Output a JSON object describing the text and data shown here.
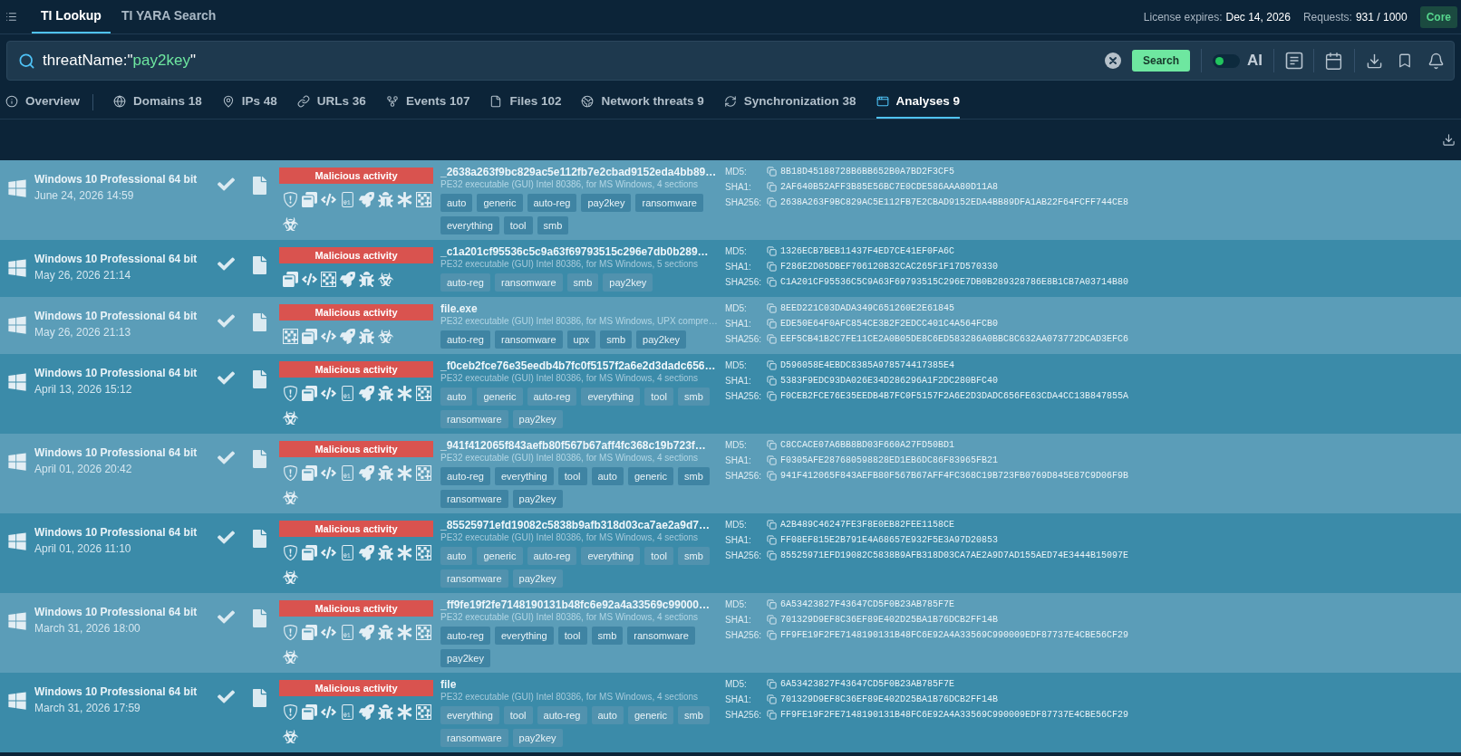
{
  "top_nav": {
    "tabs": [
      {
        "label": "TI Lookup",
        "selected": true
      },
      {
        "label": "TI YARA Search",
        "selected": false
      }
    ],
    "license": {
      "label": "License expires:",
      "value": "Dec 14, 2026"
    },
    "requests": {
      "label": "Requests:",
      "value": "931 / 1000"
    },
    "plan": "Core"
  },
  "search": {
    "query": [
      {
        "kind": "field",
        "text": "threatName:\""
      },
      {
        "kind": "value",
        "text": "pay2key"
      },
      {
        "kind": "field",
        "text": "\""
      }
    ],
    "button": "Search",
    "ai": {
      "label": "AI",
      "on": false
    }
  },
  "result_tabs": [
    {
      "kind": "info",
      "label": "Overview",
      "selected": false
    },
    {
      "kind": "globe",
      "label": "Domains 18",
      "selected": false
    },
    {
      "kind": "pin",
      "label": "IPs 48",
      "selected": false
    },
    {
      "kind": "link",
      "label": "URLs 36",
      "selected": false
    },
    {
      "kind": "fork",
      "label": "Events 107",
      "selected": false
    },
    {
      "kind": "file",
      "label": "Files 102",
      "selected": false
    },
    {
      "kind": "network",
      "label": "Network threats 9",
      "selected": false
    },
    {
      "kind": "sync",
      "label": "Synchronization 38",
      "selected": false
    },
    {
      "kind": "window",
      "label": "Analyses 9",
      "selected": true
    }
  ],
  "analyses": [
    {
      "os": "Windows 10 Professional 64 bit",
      "date": "June 24, 2026 14:59",
      "verdict": {
        "kind": "malicious",
        "label": "Malicious activity"
      },
      "indicators": [
        {
          "kind": "shield"
        },
        {
          "kind": "windows"
        },
        {
          "kind": "code"
        },
        {
          "kind": "binary"
        },
        {
          "kind": "rocket"
        },
        {
          "kind": "bug"
        },
        {
          "kind": "asterisk"
        },
        {
          "kind": "grid"
        },
        {
          "kind": "biohazard"
        }
      ],
      "name": "_2638a263f9bc829ac5e112fb7e2cbad9152eda4bb89…",
      "description": "PE32 executable (GUI) Intel 80386, for MS Windows, 4 sections",
      "tags": [
        "auto",
        "generic",
        "auto-reg",
        "pay2key",
        "ransomware",
        "everything",
        "tool",
        "smb"
      ],
      "hashes": [
        {
          "label": "MD5:",
          "value": "8B18D45188728B6BB652B0A7BD2F3CF5"
        },
        {
          "label": "SHA1:",
          "value": "2AF640B52AFF3B85E56BC7E0CDE586AAA80D11A8"
        },
        {
          "label": "SHA256:",
          "value": "2638A263F9BC829AC5E112FB7E2CBAD9152EDA4BB89DFA1AB22F64FCFF744CE8"
        }
      ]
    },
    {
      "os": "Windows 10 Professional 64 bit",
      "date": "May 26, 2026 21:14",
      "verdict": {
        "kind": "malicious",
        "label": "Malicious activity"
      },
      "indicators": [
        {
          "kind": "windows"
        },
        {
          "kind": "code"
        },
        {
          "kind": "grid"
        },
        {
          "kind": "rocket"
        },
        {
          "kind": "bug"
        },
        {
          "kind": "biohazard"
        }
      ],
      "name": "_c1a201cf95536c5c9a63f69793515c296e7db0b289…",
      "description": "PE32 executable (GUI) Intel 80386, for MS Windows, 5 sections",
      "tags": [
        "auto-reg",
        "ransomware",
        "smb",
        "pay2key"
      ],
      "hashes": [
        {
          "label": "MD5:",
          "value": "1326ECB7BEB11437F4ED7CE41EF0FA6C"
        },
        {
          "label": "SHA1:",
          "value": "F286E2D05DBEF706120B32CAC265F1F17D570330"
        },
        {
          "label": "SHA256:",
          "value": "C1A201CF95536C5C9A63F69793515C296E7DB0B289328786E8B1CB7A03714B80"
        }
      ]
    },
    {
      "os": "Windows 10 Professional 64 bit",
      "date": "May 26, 2026 21:13",
      "verdict": {
        "kind": "malicious",
        "label": "Malicious activity"
      },
      "indicators": [
        {
          "kind": "grid"
        },
        {
          "kind": "windows"
        },
        {
          "kind": "code"
        },
        {
          "kind": "rocket"
        },
        {
          "kind": "bug"
        },
        {
          "kind": "biohazard"
        }
      ],
      "name": "file.exe",
      "description": "PE32 executable (GUI) Intel 80386, for MS Windows, UPX compre…",
      "tags": [
        "auto-reg",
        "ransomware",
        "upx",
        "smb",
        "pay2key"
      ],
      "hashes": [
        {
          "label": "MD5:",
          "value": "8EED221C03DADA349C651260E2E61845"
        },
        {
          "label": "SHA1:",
          "value": "EDE50E64F0AFC854CE3B2F2EDCC401C4A564FCB0"
        },
        {
          "label": "SHA256:",
          "value": "EEF5CB41B2C7FE11CE2A0B05DE8C6ED583286A0BBC8C632AA073772DCAD3EFC6"
        }
      ]
    },
    {
      "os": "Windows 10 Professional 64 bit",
      "date": "April 13, 2026 15:12",
      "verdict": {
        "kind": "malicious",
        "label": "Malicious activity"
      },
      "indicators": [
        {
          "kind": "shield"
        },
        {
          "kind": "windows"
        },
        {
          "kind": "code"
        },
        {
          "kind": "binary"
        },
        {
          "kind": "rocket"
        },
        {
          "kind": "bug"
        },
        {
          "kind": "asterisk"
        },
        {
          "kind": "grid"
        },
        {
          "kind": "biohazard"
        }
      ],
      "name": "_f0ceb2fce76e35eedb4b7fc0f5157f2a6e2d3dadc656…",
      "description": "PE32 executable (GUI) Intel 80386, for MS Windows, 4 sections",
      "tags": [
        "auto",
        "generic",
        "auto-reg",
        "everything",
        "tool",
        "smb",
        "ransomware",
        "pay2key"
      ],
      "hashes": [
        {
          "label": "MD5:",
          "value": "D596058E4EBDC8385A978574417385E4"
        },
        {
          "label": "SHA1:",
          "value": "5383F9EDC93DA026E34D286296A1F2DC280BFC40"
        },
        {
          "label": "SHA256:",
          "value": "F0CEB2FCE76E35EEDB4B7FC0F5157F2A6E2D3DADC656FE63CDA4CC13B847855A"
        }
      ]
    },
    {
      "os": "Windows 10 Professional 64 bit",
      "date": "April 01, 2026 20:42",
      "verdict": {
        "kind": "malicious",
        "label": "Malicious activity"
      },
      "indicators": [
        {
          "kind": "shield"
        },
        {
          "kind": "windows"
        },
        {
          "kind": "code"
        },
        {
          "kind": "binary"
        },
        {
          "kind": "rocket"
        },
        {
          "kind": "bug"
        },
        {
          "kind": "asterisk"
        },
        {
          "kind": "grid"
        },
        {
          "kind": "biohazard"
        }
      ],
      "name": "_941f412065f843aefb80f567b67aff4fc368c19b723f…",
      "description": "PE32 executable (GUI) Intel 80386, for MS Windows, 4 sections",
      "tags": [
        "auto-reg",
        "everything",
        "tool",
        "auto",
        "generic",
        "smb",
        "ransomware",
        "pay2key"
      ],
      "hashes": [
        {
          "label": "MD5:",
          "value": "C8CCACE07A6BB8BD03F660A27FD50BD1"
        },
        {
          "label": "SHA1:",
          "value": "F0305AFE287680598828ED1EB6DC86F83965FB21"
        },
        {
          "label": "SHA256:",
          "value": "941F412065F843AEFB80F567B67AFF4FC368C19B723FB0769D845E87C9D06F9B"
        }
      ]
    },
    {
      "os": "Windows 10 Professional 64 bit",
      "date": "April 01, 2026 11:10",
      "verdict": {
        "kind": "malicious",
        "label": "Malicious activity"
      },
      "indicators": [
        {
          "kind": "shield"
        },
        {
          "kind": "windows"
        },
        {
          "kind": "code"
        },
        {
          "kind": "binary"
        },
        {
          "kind": "rocket"
        },
        {
          "kind": "bug"
        },
        {
          "kind": "asterisk"
        },
        {
          "kind": "grid"
        },
        {
          "kind": "biohazard"
        }
      ],
      "name": "_85525971efd19082c5838b9afb318d03ca7ae2a9d7…",
      "description": "PE32 executable (GUI) Intel 80386, for MS Windows, 4 sections",
      "tags": [
        "auto",
        "generic",
        "auto-reg",
        "everything",
        "tool",
        "smb",
        "ransomware",
        "pay2key"
      ],
      "hashes": [
        {
          "label": "MD5:",
          "value": "A2B489C46247FE3F8E0EB82FEE1158CE"
        },
        {
          "label": "SHA1:",
          "value": "FF08EF815E2B791E4A68657E932F5E3A97D20853"
        },
        {
          "label": "SHA256:",
          "value": "85525971EFD19082C5838B9AFB318D03CA7AE2A9D7AD155AED74E3444B15097E"
        }
      ]
    },
    {
      "os": "Windows 10 Professional 64 bit",
      "date": "March 31, 2026 18:00",
      "verdict": {
        "kind": "malicious",
        "label": "Malicious activity"
      },
      "indicators": [
        {
          "kind": "shield"
        },
        {
          "kind": "windows"
        },
        {
          "kind": "code"
        },
        {
          "kind": "binary"
        },
        {
          "kind": "rocket"
        },
        {
          "kind": "bug"
        },
        {
          "kind": "asterisk"
        },
        {
          "kind": "grid"
        },
        {
          "kind": "biohazard"
        }
      ],
      "name": "_ff9fe19f2fe7148190131b48fc6e92a4a33569c99000…",
      "description": "PE32 executable (GUI) Intel 80386, for MS Windows, 4 sections",
      "tags": [
        "auto-reg",
        "everything",
        "tool",
        "smb",
        "ransomware",
        "pay2key"
      ],
      "hashes": [
        {
          "label": "MD5:",
          "value": "6A53423827F43647CD5F0B23AB785F7E"
        },
        {
          "label": "SHA1:",
          "value": "701329D9EF8C36EF89E402D25BA1B76DCB2FF14B"
        },
        {
          "label": "SHA256:",
          "value": "FF9FE19F2FE7148190131B48FC6E92A4A33569C990009EDF87737E4CBE56CF29"
        }
      ]
    },
    {
      "os": "Windows 10 Professional 64 bit",
      "date": "March 31, 2026 17:59",
      "verdict": {
        "kind": "malicious",
        "label": "Malicious activity"
      },
      "indicators": [
        {
          "kind": "shield"
        },
        {
          "kind": "windows"
        },
        {
          "kind": "code"
        },
        {
          "kind": "binary"
        },
        {
          "kind": "rocket"
        },
        {
          "kind": "bug"
        },
        {
          "kind": "asterisk"
        },
        {
          "kind": "grid"
        },
        {
          "kind": "biohazard"
        }
      ],
      "name": "file",
      "description": "PE32 executable (GUI) Intel 80386, for MS Windows, 4 sections",
      "tags": [
        "everything",
        "tool",
        "auto-reg",
        "auto",
        "generic",
        "smb",
        "ransomware",
        "pay2key"
      ],
      "hashes": [
        {
          "label": "MD5:",
          "value": "6A53423827F43647CD5F0B23AB785F7E"
        },
        {
          "label": "SHA1:",
          "value": "701329D9EF8C36EF89E402D25BA1B76DCB2FF14B"
        },
        {
          "label": "SHA256:",
          "value": "FF9FE19F2FE7148190131B48FC6E92A4A33569C990009EDF87737E4CBE56CF29"
        }
      ]
    }
  ]
}
